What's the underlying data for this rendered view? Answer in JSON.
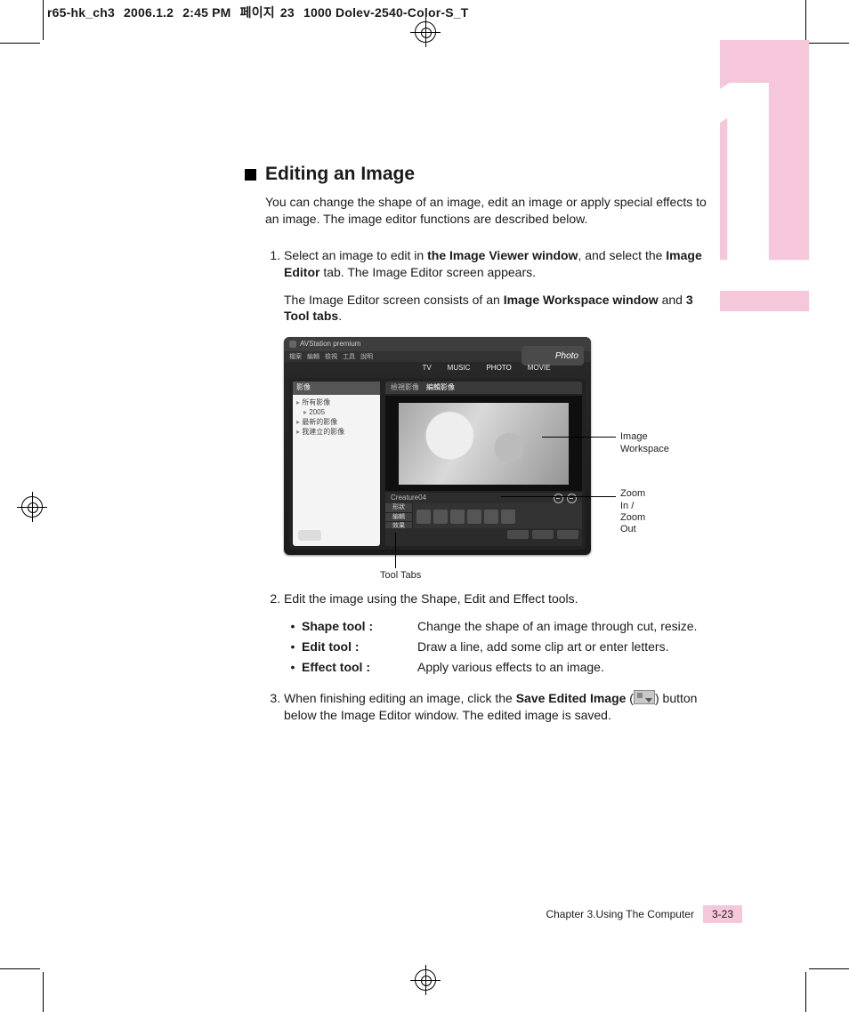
{
  "header": {
    "file": "r65-hk_ch3",
    "date": "2006.1.2",
    "time": "2:45 PM",
    "page_ko_prefix": "페이지",
    "page_ko_num": "23",
    "printprofile": "1000 Dolev-2540-Color-S_T"
  },
  "side_tab": {
    "bignum": "1"
  },
  "heading": "Editing an Image",
  "intro": "You can change the shape of an image, edit an image or apply special effects to an image. The image editor functions are described below.",
  "step1": {
    "pre": "Select an image to edit in ",
    "b1": "the Image Viewer window",
    "mid1": ", and select the ",
    "b2": "Image Editor",
    "mid2": " tab. The Image Editor screen appears.",
    "sub_pre": "The Image Editor screen consists of an ",
    "sub_b1": "Image Workspace window",
    "sub_mid": " and ",
    "sub_b2": "3 Tool tabs",
    "sub_post": "."
  },
  "screenshot": {
    "app_title": "AVStation premium",
    "menus": [
      "檔案",
      "編輯",
      "檢視",
      "工具",
      "說明"
    ],
    "badge": "Photo",
    "modes": [
      "TV",
      "MUSIC",
      "PHOTO",
      "MOVIE"
    ],
    "side_header": "影像",
    "side_items": [
      "所有影像",
      "2005",
      "最新的影像",
      "我建立的影像"
    ],
    "editor_tabs": [
      "檢視影像",
      "編輯影像"
    ],
    "status_filename": "Creature04",
    "tool_tab_labels": [
      "形狀",
      "編輯",
      "效果"
    ]
  },
  "callouts": {
    "workspace": "Image Workspace",
    "zoom": "Zoom In /\nZoom Out",
    "tooltabs": "Tool Tabs"
  },
  "step2": "Edit the image using the Shape, Edit and Effect tools.",
  "tools": [
    {
      "name": "Shape tool :",
      "desc": "Change the shape of an image through cut, resize."
    },
    {
      "name": "Edit tool :",
      "desc": "Draw a line, add some clip art or enter letters."
    },
    {
      "name": "Effect tool :",
      "desc": "Apply various effects to an image."
    }
  ],
  "step3": {
    "pre": "When finishing editing an image, click the ",
    "b1": "Save Edited Image",
    "mid": " (",
    "post": ") button below the Image Editor window. The edited image is saved."
  },
  "footer": {
    "chapter": "Chapter 3.Using The Computer",
    "page": "3-23"
  }
}
